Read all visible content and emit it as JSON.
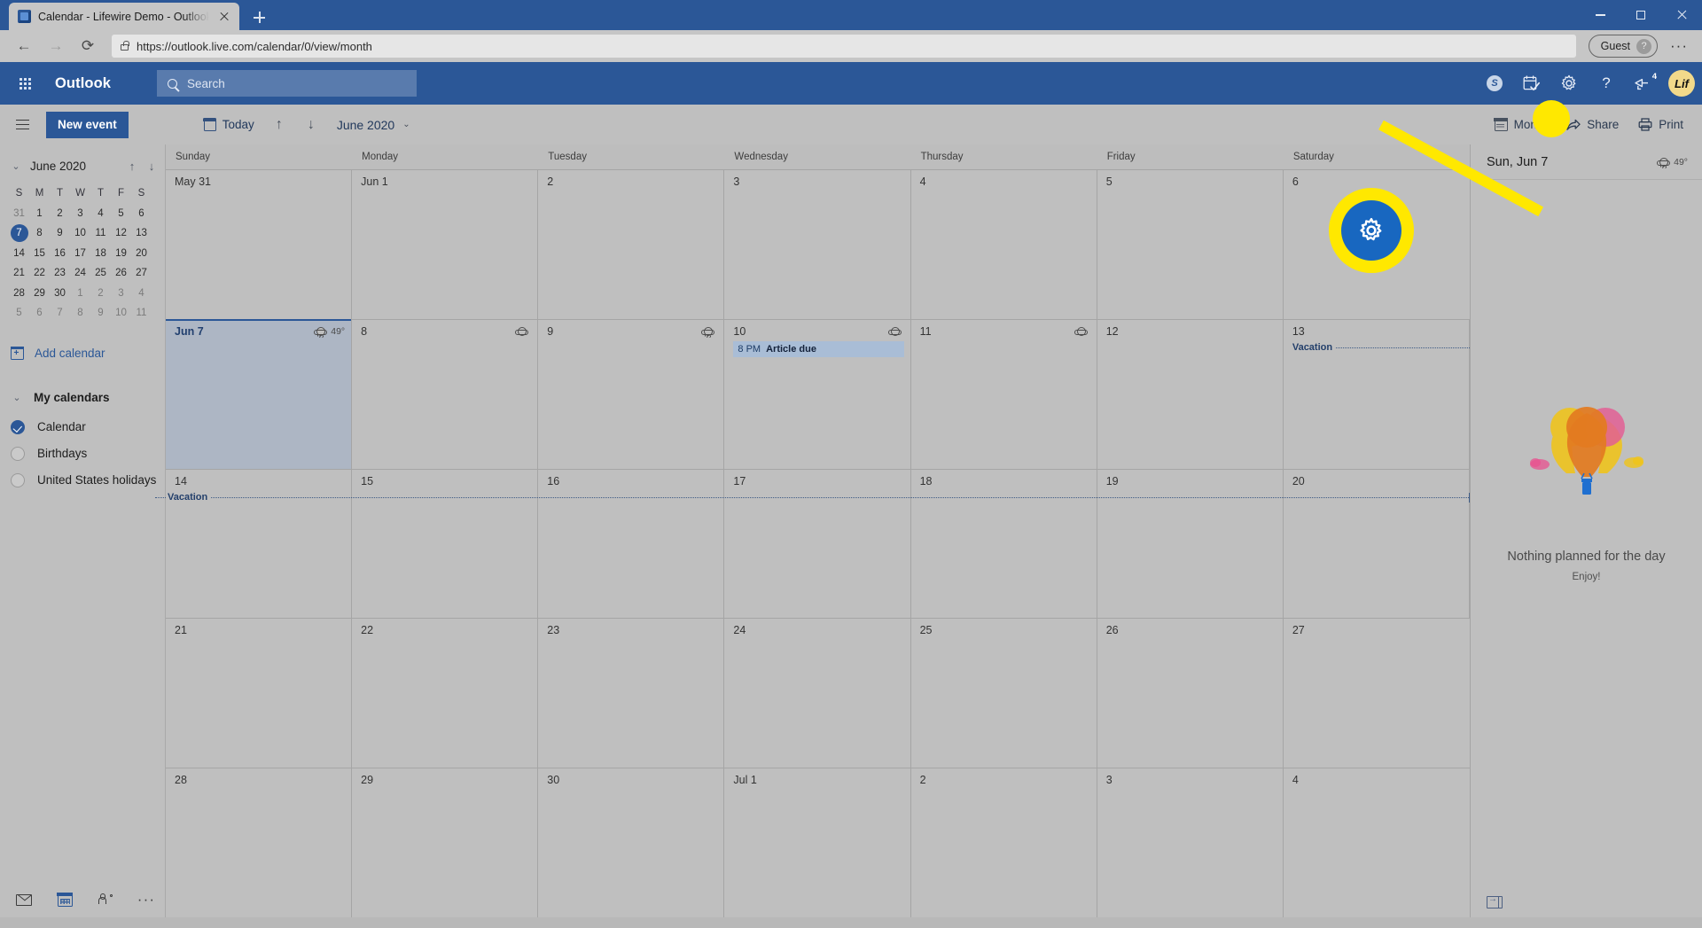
{
  "browser": {
    "tab_title": "Calendar - Lifewire Demo - Outlook",
    "new_tab_label": "+",
    "back_label": "←",
    "forward_label": "→",
    "reload_label": "⟳",
    "url": "https://outlook.live.com/calendar/0/view/month",
    "profile_label": "Guest",
    "profile_avatar_glyph": "?",
    "more_label": "···",
    "minimize_label": "—",
    "maximize_label": "□",
    "close_label": "✕"
  },
  "header": {
    "brand": "Outlook",
    "search_placeholder": "Search",
    "icons": [
      {
        "name": "skype-icon",
        "glyph": "S"
      },
      {
        "name": "calendar-check-icon",
        "glyph": ""
      },
      {
        "name": "settings-gear-icon",
        "glyph": ""
      },
      {
        "name": "help-icon",
        "glyph": "?"
      },
      {
        "name": "feedback-icon",
        "glyph": "",
        "badge": "4"
      }
    ],
    "avatar_text": "Lif"
  },
  "toolbar": {
    "new_event_label": "New event",
    "today_label": "Today",
    "prev_label": "↑",
    "next_label": "↓",
    "month_picker_label": "June 2020",
    "chevron": "⌄",
    "view_label": "Month",
    "share_label": "Share",
    "print_label": "Print"
  },
  "sidebar": {
    "mini_calendar": {
      "title": "June 2020",
      "prev": "↑",
      "next": "↓",
      "dow": [
        "S",
        "M",
        "T",
        "W",
        "T",
        "F",
        "S"
      ],
      "weeks": [
        [
          {
            "d": "31",
            "muted": true
          },
          {
            "d": "1"
          },
          {
            "d": "2"
          },
          {
            "d": "3"
          },
          {
            "d": "4"
          },
          {
            "d": "5"
          },
          {
            "d": "6"
          }
        ],
        [
          {
            "d": "7",
            "today": true
          },
          {
            "d": "8"
          },
          {
            "d": "9"
          },
          {
            "d": "10"
          },
          {
            "d": "11"
          },
          {
            "d": "12"
          },
          {
            "d": "13"
          }
        ],
        [
          {
            "d": "14"
          },
          {
            "d": "15"
          },
          {
            "d": "16"
          },
          {
            "d": "17"
          },
          {
            "d": "18"
          },
          {
            "d": "19"
          },
          {
            "d": "20"
          }
        ],
        [
          {
            "d": "21"
          },
          {
            "d": "22"
          },
          {
            "d": "23"
          },
          {
            "d": "24"
          },
          {
            "d": "25"
          },
          {
            "d": "26"
          },
          {
            "d": "27"
          }
        ],
        [
          {
            "d": "28"
          },
          {
            "d": "29"
          },
          {
            "d": "30"
          },
          {
            "d": "1",
            "muted": true
          },
          {
            "d": "2",
            "muted": true
          },
          {
            "d": "3",
            "muted": true
          },
          {
            "d": "4",
            "muted": true
          }
        ],
        [
          {
            "d": "5",
            "muted": true
          },
          {
            "d": "6",
            "muted": true
          },
          {
            "d": "7",
            "muted": true
          },
          {
            "d": "8",
            "muted": true
          },
          {
            "d": "9",
            "muted": true
          },
          {
            "d": "10",
            "muted": true
          },
          {
            "d": "11",
            "muted": true
          }
        ]
      ]
    },
    "add_calendar_label": "Add calendar",
    "my_calendars_label": "My calendars",
    "calendars": [
      {
        "name": "Calendar",
        "checked": true
      },
      {
        "name": "Birthdays",
        "checked": false
      },
      {
        "name": "United States holidays",
        "checked": false
      }
    ],
    "bottom_nav": [
      {
        "name": "mail-icon"
      },
      {
        "name": "calendar-icon"
      },
      {
        "name": "people-icon"
      },
      {
        "name": "more-apps-icon",
        "glyph": "···"
      }
    ]
  },
  "calendar": {
    "day_headers": [
      "Sunday",
      "Monday",
      "Tuesday",
      "Wednesday",
      "Thursday",
      "Friday",
      "Saturday"
    ],
    "weeks": [
      {
        "days": [
          {
            "label": "May 31"
          },
          {
            "label": "Jun 1"
          },
          {
            "label": "2"
          },
          {
            "label": "3"
          },
          {
            "label": "4"
          },
          {
            "label": "5"
          },
          {
            "label": "6"
          }
        ]
      },
      {
        "days": [
          {
            "label": "Jun 7",
            "selected": true,
            "weather": "49°",
            "weather_icon": "rain"
          },
          {
            "label": "8"
          },
          {
            "label": "9",
            "weather_icon": "cloud",
            "weather_on_left": true
          },
          {
            "label": "10",
            "weather_icon": "rain",
            "weather_on_left": true,
            "events": [
              {
                "time": "8 PM",
                "title": "Article due"
              }
            ]
          },
          {
            "label": "11",
            "weather_icon": "cloud",
            "weather_on_left": true
          },
          {
            "label": "12",
            "weather_icon": "cloud",
            "weather_on_left": true
          },
          {
            "label": "13",
            "allday": "Vacation"
          }
        ]
      },
      {
        "days": [
          {
            "label": "14",
            "allday_continued": "Vacation"
          },
          {
            "label": "15"
          },
          {
            "label": "16"
          },
          {
            "label": "17"
          },
          {
            "label": "18"
          },
          {
            "label": "19"
          },
          {
            "label": "20"
          }
        ]
      },
      {
        "days": [
          {
            "label": "21"
          },
          {
            "label": "22"
          },
          {
            "label": "23"
          },
          {
            "label": "24"
          },
          {
            "label": "25"
          },
          {
            "label": "26"
          },
          {
            "label": "27"
          }
        ]
      },
      {
        "days": [
          {
            "label": "28"
          },
          {
            "label": "29"
          },
          {
            "label": "30"
          },
          {
            "label": "Jul 1"
          },
          {
            "label": "2"
          },
          {
            "label": "3"
          },
          {
            "label": "4"
          }
        ]
      }
    ]
  },
  "day_panel": {
    "title": "Sun, Jun 7",
    "weather": "49°",
    "empty_message": "Nothing planned for the day",
    "empty_sub": "Enjoy!"
  },
  "annotation": {
    "highlight_target": "settings-gear-icon",
    "ring_color": "#ffe800",
    "button_color": "#1867c0"
  }
}
